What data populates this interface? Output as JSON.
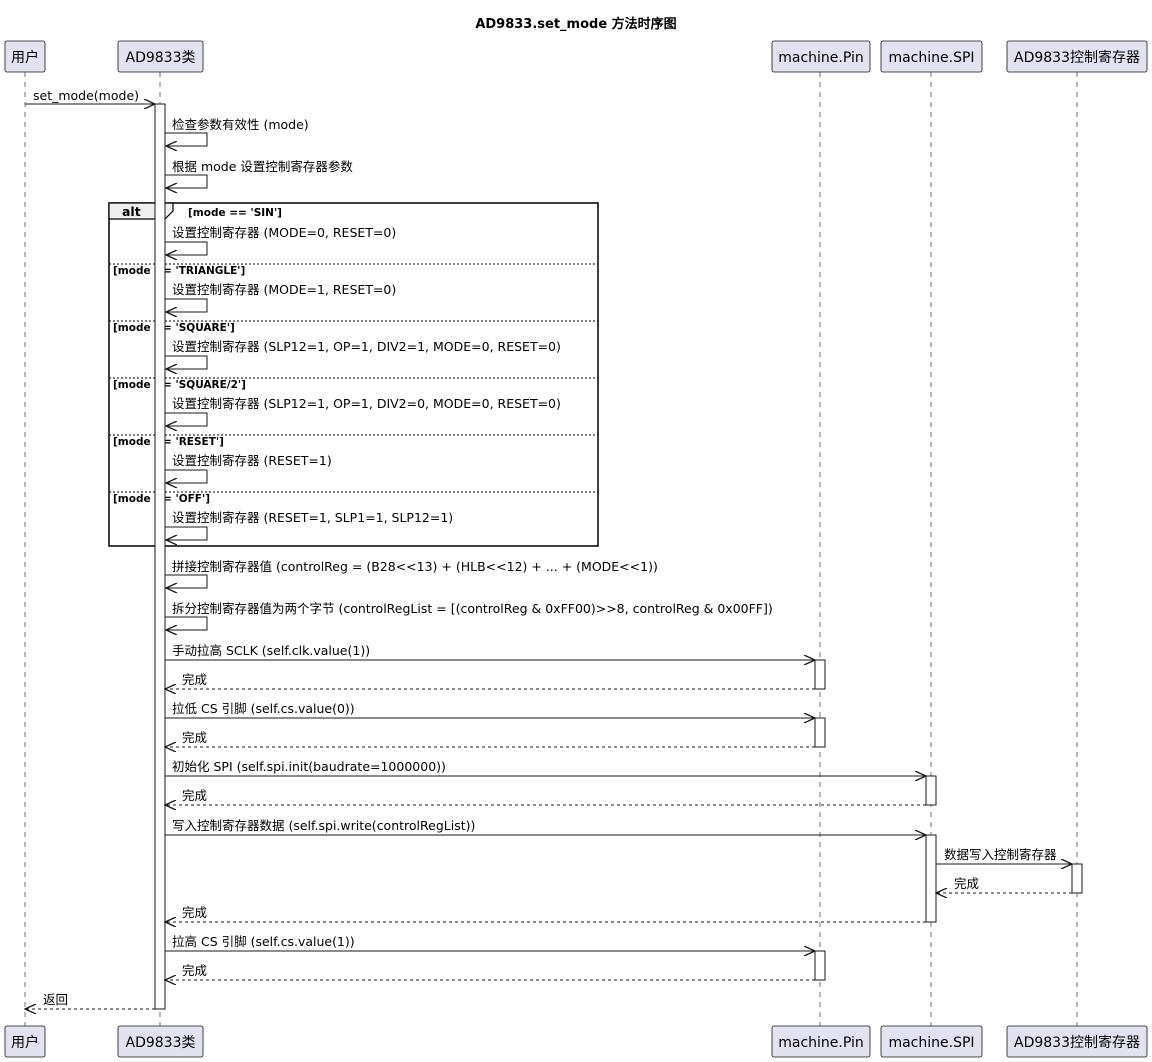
{
  "title": "AD9833.set_mode 方法时序图",
  "participants": [
    {
      "id": "user",
      "label": "用户"
    },
    {
      "id": "ad",
      "label": "AD9833类"
    },
    {
      "id": "pin",
      "label": "machine.Pin"
    },
    {
      "id": "spi",
      "label": "machine.SPI"
    },
    {
      "id": "reg",
      "label": "AD9833控制寄存器"
    }
  ],
  "messages": [
    {
      "from": "user",
      "to": "ad",
      "text": "set_mode(mode)",
      "kind": "sync"
    },
    {
      "from": "ad",
      "to": "ad",
      "text": "检查参数有效性 (mode)",
      "kind": "self"
    },
    {
      "from": "ad",
      "to": "ad",
      "text": "根据 mode 设置控制寄存器参数",
      "kind": "self"
    },
    {
      "from": "ad",
      "to": "ad",
      "text": "设置控制寄存器 (MODE=0, RESET=0)",
      "kind": "self"
    },
    {
      "from": "ad",
      "to": "ad",
      "text": "设置控制寄存器 (MODE=1, RESET=0)",
      "kind": "self"
    },
    {
      "from": "ad",
      "to": "ad",
      "text": "设置控制寄存器 (SLP12=1, OP=1, DIV2=1, MODE=0, RESET=0)",
      "kind": "self"
    },
    {
      "from": "ad",
      "to": "ad",
      "text": "设置控制寄存器 (SLP12=1, OP=1, DIV2=0, MODE=0, RESET=0)",
      "kind": "self"
    },
    {
      "from": "ad",
      "to": "ad",
      "text": "设置控制寄存器 (RESET=1)",
      "kind": "self"
    },
    {
      "from": "ad",
      "to": "ad",
      "text": "设置控制寄存器 (RESET=1, SLP1=1, SLP12=1)",
      "kind": "self"
    },
    {
      "from": "ad",
      "to": "ad",
      "text": "拼接控制寄存器值 (controlReg = (B28<<13) + (HLB<<12) + ... + (MODE<<1))",
      "kind": "self"
    },
    {
      "from": "ad",
      "to": "ad",
      "text": "拆分控制寄存器值为两个字节 (controlRegList = [(controlReg & 0xFF00)>>8, controlReg & 0x00FF])",
      "kind": "self"
    },
    {
      "from": "ad",
      "to": "pin",
      "text": "手动拉高 SCLK (self.clk.value(1))",
      "kind": "sync"
    },
    {
      "from": "pin",
      "to": "ad",
      "text": "完成",
      "kind": "return"
    },
    {
      "from": "ad",
      "to": "pin",
      "text": "拉低 CS 引脚 (self.cs.value(0))",
      "kind": "sync"
    },
    {
      "from": "pin",
      "to": "ad",
      "text": "完成",
      "kind": "return"
    },
    {
      "from": "ad",
      "to": "spi",
      "text": "初始化 SPI (self.spi.init(baudrate=1000000))",
      "kind": "sync"
    },
    {
      "from": "spi",
      "to": "ad",
      "text": "完成",
      "kind": "return"
    },
    {
      "from": "ad",
      "to": "spi",
      "text": "写入控制寄存器数据 (self.spi.write(controlRegList))",
      "kind": "sync"
    },
    {
      "from": "spi",
      "to": "reg",
      "text": "数据写入控制寄存器",
      "kind": "sync"
    },
    {
      "from": "reg",
      "to": "spi",
      "text": "完成",
      "kind": "return"
    },
    {
      "from": "spi",
      "to": "ad",
      "text": "完成",
      "kind": "return"
    },
    {
      "from": "ad",
      "to": "pin",
      "text": "拉高 CS 引脚 (self.cs.value(1))",
      "kind": "sync"
    },
    {
      "from": "pin",
      "to": "ad",
      "text": "完成",
      "kind": "return"
    },
    {
      "from": "ad",
      "to": "user",
      "text": "返回",
      "kind": "return"
    }
  ],
  "alt_fragment": {
    "label": "alt",
    "guards": [
      "[mode == 'SIN']",
      "[mode == 'TRIANGLE']",
      "[mode == 'SQUARE']",
      "[mode == 'SQUARE/2']",
      "[mode == 'RESET']",
      "[mode == 'OFF']"
    ]
  },
  "colors": {
    "participant_fill": "#e2e2f0",
    "participant_border": "#181818",
    "line": "#181818",
    "fragment_label_fill": "#eeeeee",
    "activation_fill": "#ffffff"
  }
}
